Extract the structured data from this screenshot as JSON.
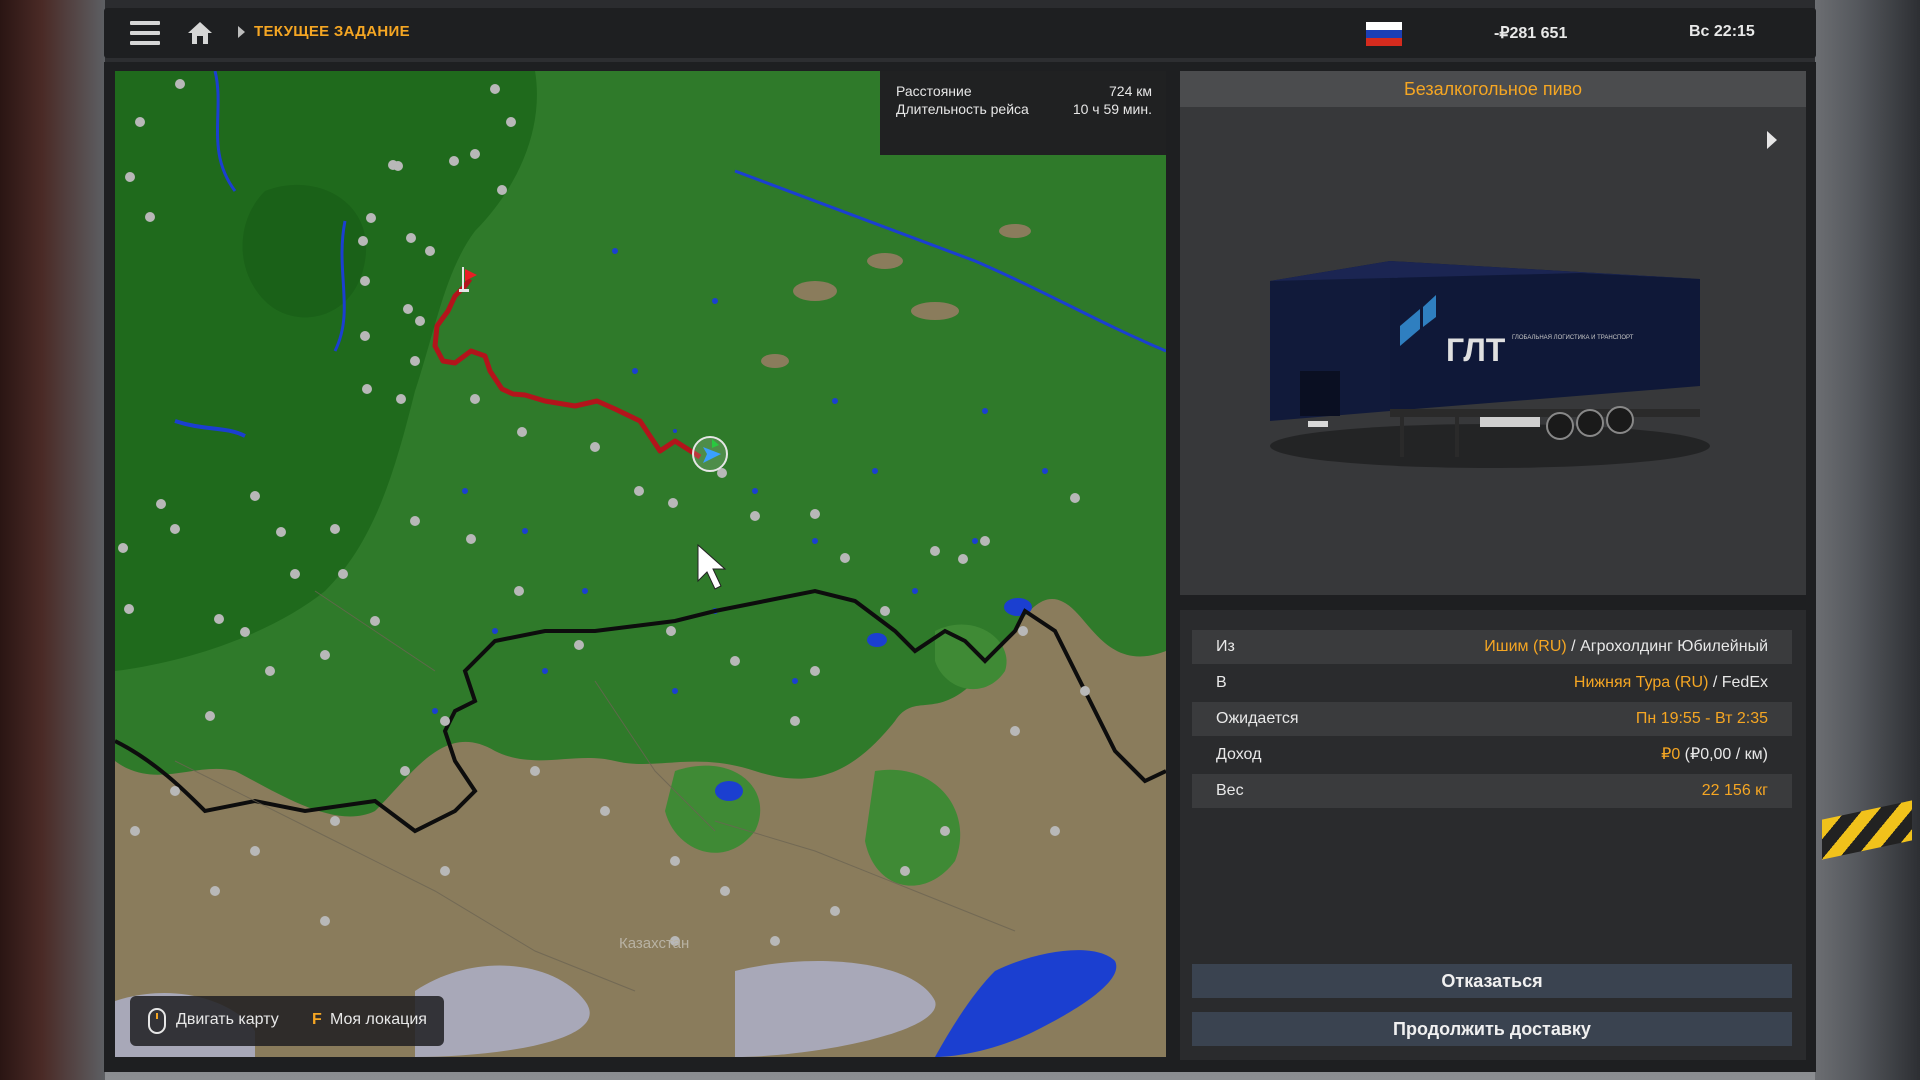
{
  "header": {
    "breadcrumb": "ТЕКУЩЕЕ ЗАДАНИЕ",
    "money": "-₽281 651",
    "clock": "Вс 22:15",
    "flag_colors": [
      "#ffffff",
      "#1c3fb5",
      "#d52b1e"
    ]
  },
  "icons": {
    "menu": "hamburger-icon",
    "home": "home-icon",
    "mouse": "mouse-icon",
    "next": "chevron-right-icon"
  },
  "map": {
    "country_label": "Казахстан",
    "colors": {
      "land": "#8a7c5c",
      "forest": "#2f7a2a",
      "dark_forest": "#1f6a1c",
      "water": "#1b3fd0",
      "route": "#b3141b",
      "border": "#0d0d0d",
      "city": "#b8b8b8"
    },
    "info": {
      "distance_label": "Расстояние",
      "distance_value": "724 км",
      "duration_label": "Длительность рейса",
      "duration_value": "10 ч 59 мин."
    },
    "hint": {
      "move_label": "Двигать карту",
      "key": "F",
      "location_label": "Моя локация"
    }
  },
  "cargo": {
    "title": "Безалкогольное пиво",
    "trailer_brand": "ГЛТ",
    "trailer_brand_sub": "ГЛОБАЛЬНАЯ ЛОГИСТИКА И ТРАНСПОРТ"
  },
  "details": {
    "from_label": "Из",
    "from_city": "Ишим (RU)",
    "from_company": " / Агрохолдинг Юбилейный",
    "to_label": "В",
    "to_city": "Нижняя Тура (RU)",
    "to_company": " / FedEx",
    "expected_label": "Ожидается",
    "expected_value": "Пн 19:55 - Вт 2:35",
    "income_label": "Доход",
    "income_value": "₽0",
    "income_rate": " (₽0,00 / км)",
    "weight_label": "Вес",
    "weight_value": "22 156 кг"
  },
  "buttons": {
    "cancel": "Отказаться",
    "continue": "Продолжить доставку"
  }
}
